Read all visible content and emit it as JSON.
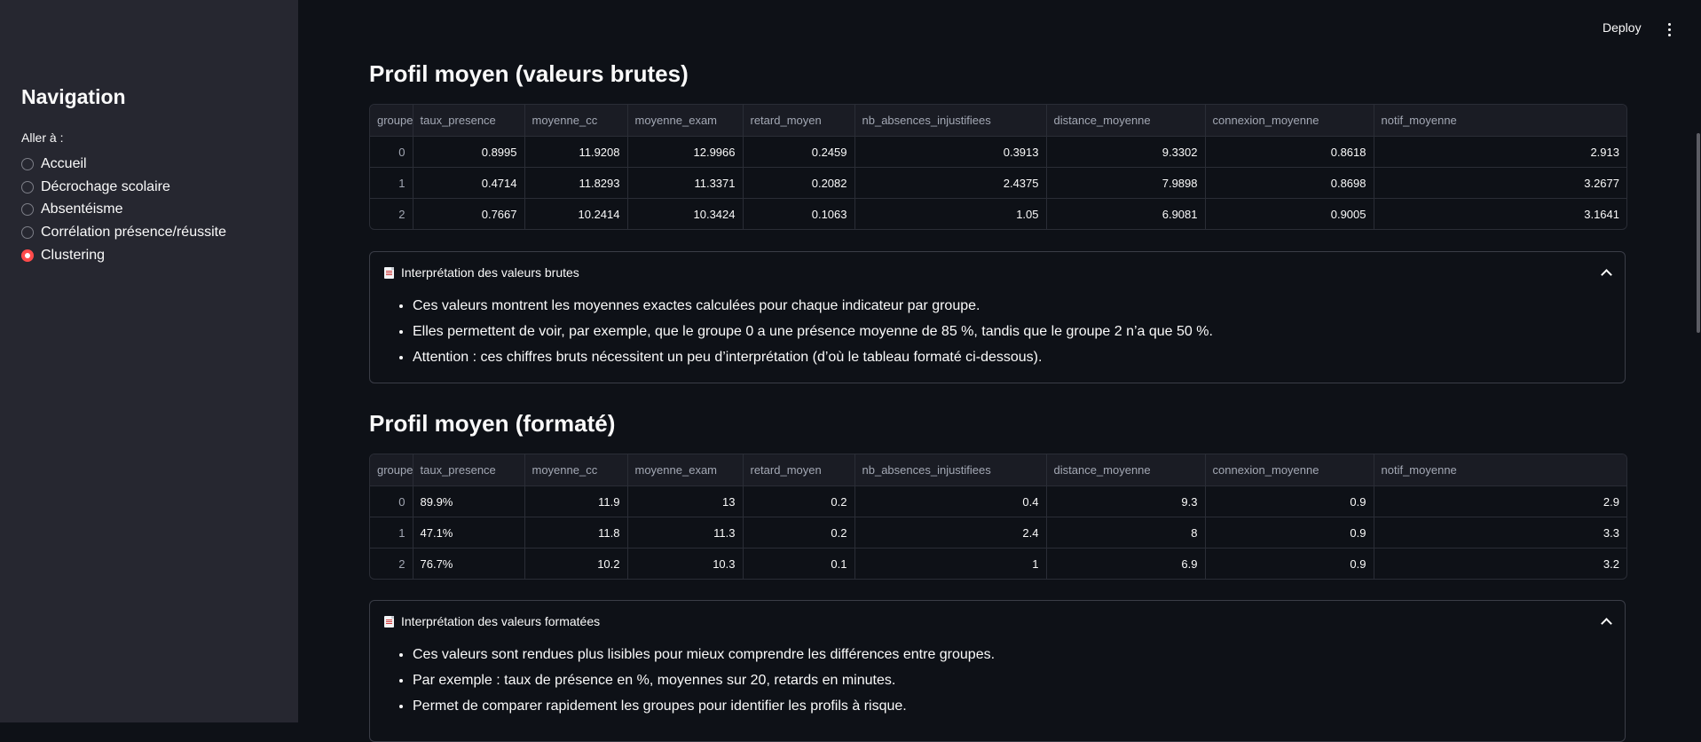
{
  "sidebar": {
    "title": "Navigation",
    "radio_label": "Aller à :",
    "items": [
      {
        "label": "Accueil",
        "selected": false
      },
      {
        "label": "Décrochage scolaire",
        "selected": false
      },
      {
        "label": "Absentéisme",
        "selected": false
      },
      {
        "label": "Corrélation présence/réussite",
        "selected": false
      },
      {
        "label": "Clustering",
        "selected": true
      }
    ]
  },
  "header": {
    "deploy_label": "Deploy",
    "menu_icon": "vertical-dots-icon"
  },
  "sections": [
    {
      "title": "Profil moyen (valeurs brutes)",
      "columns": [
        "groupe",
        "taux_presence",
        "moyenne_cc",
        "moyenne_exam",
        "retard_moyen",
        "nb_absences_injustifiees",
        "distance_moyenne",
        "connexion_moyenne",
        "notif_moyenne"
      ],
      "rows": [
        [
          "0",
          "0.8995",
          "11.9208",
          "12.9966",
          "0.2459",
          "0.3913",
          "9.3302",
          "0.8618",
          "2.913"
        ],
        [
          "1",
          "0.4714",
          "11.8293",
          "11.3371",
          "0.2082",
          "2.4375",
          "7.9898",
          "0.8698",
          "3.2677"
        ],
        [
          "2",
          "0.7667",
          "10.2414",
          "10.3424",
          "0.1063",
          "1.05",
          "6.9081",
          "0.9005",
          "3.1641"
        ]
      ],
      "expander": {
        "title": "Interprétation des valeurs brutes",
        "icon": "document-icon",
        "bullets": [
          "Ces valeurs montrent les moyennes exactes calculées pour chaque indicateur par groupe.",
          "Elles permettent de voir, par exemple, que le groupe 0 a une présence moyenne de 85 %, tandis que le groupe 2 n’a que 50 %.",
          "Attention : ces chiffres bruts nécessitent un peu d’interprétation (d’où le tableau formaté ci-dessous)."
        ]
      }
    },
    {
      "title": "Profil moyen (formaté)",
      "columns": [
        "groupe",
        "taux_presence",
        "moyenne_cc",
        "moyenne_exam",
        "retard_moyen",
        "nb_absences_injustifiees",
        "distance_moyenne",
        "connexion_moyenne",
        "notif_moyenne"
      ],
      "rows": [
        [
          "0",
          "89.9%",
          "11.9",
          "13",
          "0.2",
          "0.4",
          "9.3",
          "0.9",
          "2.9"
        ],
        [
          "1",
          "47.1%",
          "11.8",
          "11.3",
          "0.2",
          "2.4",
          "8",
          "0.9",
          "3.3"
        ],
        [
          "2",
          "76.7%",
          "10.2",
          "10.3",
          "0.1",
          "1",
          "6.9",
          "0.9",
          "3.2"
        ]
      ],
      "expander": {
        "title": "Interprétation des valeurs formatées",
        "icon": "document-icon",
        "bullets": [
          "Ces valeurs sont rendues plus lisibles pour mieux comprendre les différences entre groupes.",
          "Par exemple : taux de présence en %, moyennes sur 20, retards en minutes.",
          "Permet de comparer rapidement les groupes pour identifier les profils à risque."
        ]
      }
    }
  ]
}
